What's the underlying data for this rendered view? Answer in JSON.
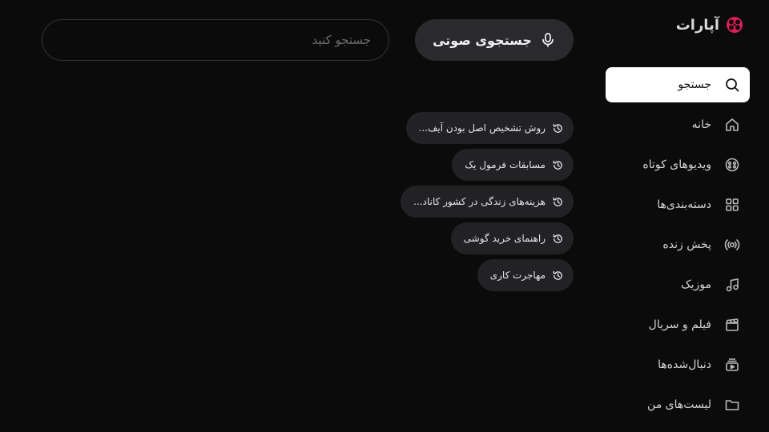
{
  "brand": {
    "name": "آپارات"
  },
  "search": {
    "placeholder": "جستجو کنید",
    "value": ""
  },
  "voice_search": {
    "label": "جستجوی صوتی"
  },
  "sidebar": {
    "items": [
      {
        "label": "جستجو",
        "icon": "search-icon",
        "active": true
      },
      {
        "label": "خانه",
        "icon": "home-icon"
      },
      {
        "label": "ویدیوهای کوتاه",
        "icon": "reel-icon"
      },
      {
        "label": "دسته‌بندی‌ها",
        "icon": "grid-icon"
      },
      {
        "label": "پخش زنده",
        "icon": "live-icon"
      },
      {
        "label": "موزیک",
        "icon": "music-icon"
      },
      {
        "label": "فیلم و سریال",
        "icon": "clapper-icon"
      },
      {
        "label": "دنبال‌شده‌ها",
        "icon": "subscriptions-icon"
      },
      {
        "label": "لیست‌های من",
        "icon": "folder-icon"
      }
    ]
  },
  "recent_searches": [
    {
      "label": "روش تشخیص اصل بودن آیف...",
      "icon": "history-icon"
    },
    {
      "label": "مسابقات فرمول یک",
      "icon": "history-icon"
    },
    {
      "label": "هزینه‌های زندگی در کشور کاناد...",
      "icon": "history-icon"
    },
    {
      "label": "راهنمای خرید گوشی",
      "icon": "history-icon"
    },
    {
      "label": "مهاجرت کاری",
      "icon": "history-icon"
    }
  ],
  "colors": {
    "accent": "#df1d5a",
    "background": "#0b0b0c",
    "chip": "#222225",
    "active_item": "#ffffff"
  }
}
